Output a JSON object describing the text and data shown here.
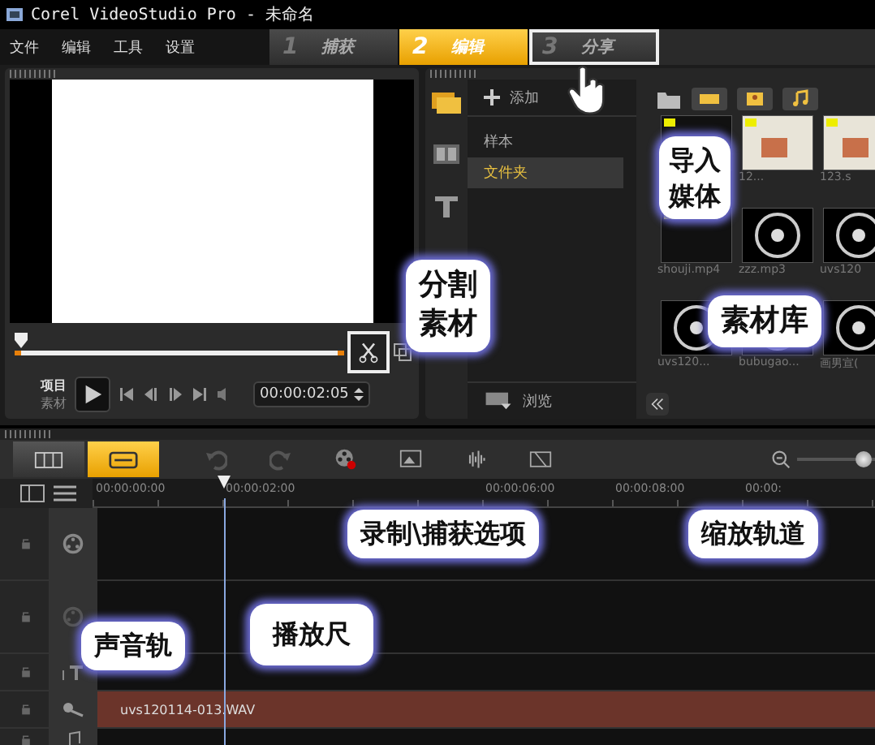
{
  "window": {
    "title": "Corel VideoStudio Pro - 未命名"
  },
  "menu": [
    "文件",
    "编辑",
    "工具",
    "设置"
  ],
  "steps": [
    {
      "number": "1",
      "label": "捕获",
      "selected": false,
      "outlined": false
    },
    {
      "number": "2",
      "label": "编辑",
      "selected": true,
      "outlined": false
    },
    {
      "number": "3",
      "label": "分享",
      "selected": false,
      "outlined": true
    }
  ],
  "preview": {
    "scrubber": {
      "level": 0
    },
    "modes": [
      {
        "label": "项目",
        "selected": true
      },
      {
        "label": "素材",
        "selected": false
      }
    ],
    "timecode": "00:00:02:05",
    "split_outlined": true
  },
  "library": {
    "add_label": "添加",
    "folders": [
      {
        "label": "样本",
        "selected": false
      },
      {
        "label": "文件夹",
        "selected": true
      }
    ],
    "browse_label": "浏览",
    "thumbnails": [
      {
        "kind": "video"
      },
      {
        "kind": "image",
        "caption": "12..."
      },
      {
        "kind": "image",
        "caption": "123.s"
      },
      {
        "kind": "video",
        "caption": "shouji.mp4"
      },
      {
        "kind": "audio",
        "caption": "zzz.mp3"
      },
      {
        "kind": "audio",
        "caption": "uvs120"
      },
      {
        "kind": "audio",
        "caption": "uvs120..."
      },
      {
        "kind": "audio",
        "caption": "bubugao..."
      },
      {
        "kind": "audio",
        "caption": "画男宣("
      }
    ]
  },
  "timeline": {
    "ruler": [
      "00:00:00:00",
      "00:00:02:00",
      "00:00:06:00",
      "00:00:08:00",
      "00:00:"
    ],
    "zoom": {
      "level": 0.85
    },
    "tracks": [
      {
        "kind": "video"
      },
      {
        "kind": "overlay"
      },
      {
        "kind": "title"
      },
      {
        "kind": "voice",
        "clip": "uvs120114-013.WAV"
      },
      {
        "kind": "music"
      }
    ]
  },
  "callouts": [
    {
      "lines": [
        "分割",
        "素材"
      ]
    },
    {
      "lines": [
        "导入",
        "媒体"
      ]
    },
    {
      "lines": [
        "素材库"
      ]
    },
    {
      "lines": [
        "录制\\捕获选项"
      ]
    },
    {
      "lines": [
        "缩放轨道"
      ]
    },
    {
      "lines": [
        "声音轨"
      ]
    },
    {
      "lines": [
        "播放尺"
      ]
    }
  ]
}
